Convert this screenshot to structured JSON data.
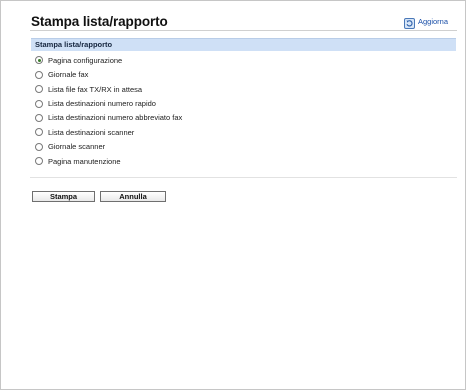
{
  "page": {
    "title": "Stampa lista/rapporto",
    "refresh_label": "Aggiorna"
  },
  "section": {
    "title": "Stampa lista/rapporto"
  },
  "options": [
    {
      "label": "Pagina configurazione",
      "selected": true
    },
    {
      "label": "Giornale fax",
      "selected": false
    },
    {
      "label": "Lista file fax TX/RX in attesa",
      "selected": false
    },
    {
      "label": "Lista destinazioni numero rapido",
      "selected": false
    },
    {
      "label": "Lista destinazioni numero abbreviato fax",
      "selected": false
    },
    {
      "label": "Lista destinazioni scanner",
      "selected": false
    },
    {
      "label": "Giornale scanner",
      "selected": false
    },
    {
      "label": "Pagina manutenzione",
      "selected": false
    }
  ],
  "buttons": {
    "print_label": "Stampa",
    "cancel_label": "Annulla"
  },
  "icons": {
    "refresh": "refresh-icon"
  },
  "colors": {
    "section_header_bg": "#cfe0f6",
    "link": "#1a4fa8",
    "radio_selected": "#3a7d2a"
  }
}
